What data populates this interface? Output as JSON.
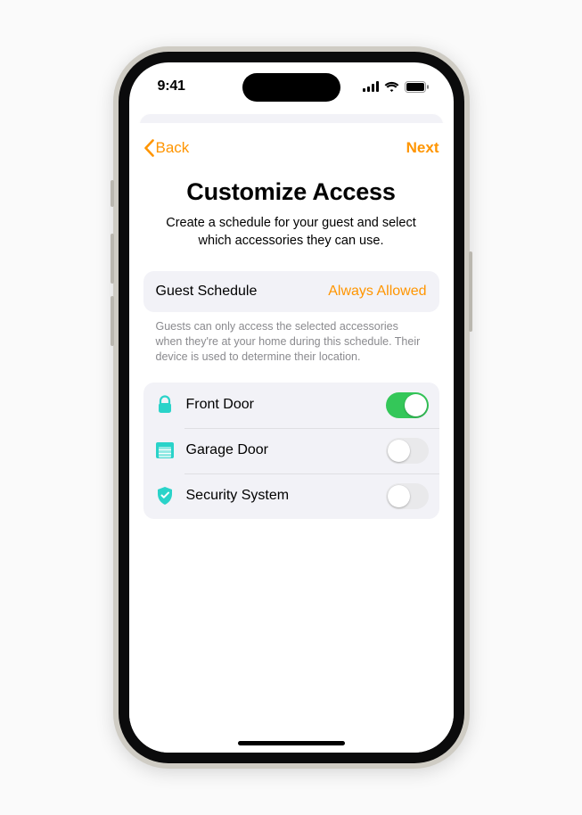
{
  "status": {
    "time": "9:41"
  },
  "nav": {
    "back": "Back",
    "next": "Next"
  },
  "page": {
    "title": "Customize Access",
    "subtitle": "Create a schedule for your guest and select which accessories they can use."
  },
  "schedule": {
    "label": "Guest Schedule",
    "value": "Always Allowed",
    "footnote": "Guests can only access the selected accessories when they're at your home during this schedule. Their device is used to determine their location."
  },
  "accessories": [
    {
      "icon": "lock",
      "label": "Front Door",
      "enabled": true
    },
    {
      "icon": "garage",
      "label": "Garage Door",
      "enabled": false
    },
    {
      "icon": "shield",
      "label": "Security System",
      "enabled": false
    }
  ],
  "colors": {
    "accent": "#ff9500",
    "teal": "#2ad3c9",
    "toggleOn": "#34c759"
  }
}
